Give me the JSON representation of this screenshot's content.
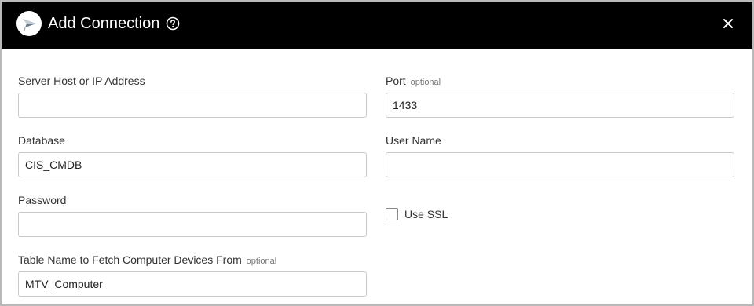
{
  "dialog": {
    "title": "Add Connection",
    "icons": {
      "logo": "paper-plane-logo-icon",
      "help": "question-circle-icon",
      "close": "close-icon"
    },
    "colors": {
      "header_background": "#000000",
      "header_text": "#ffffff",
      "border": "#b9b9b9",
      "input_border": "#c9c9c9",
      "optional_text": "#757575"
    }
  },
  "form": {
    "optional_tag": "optional",
    "server_host": {
      "label": "Server Host or IP Address",
      "value": ""
    },
    "port": {
      "label": "Port",
      "optional": "optional",
      "value": "1433"
    },
    "database": {
      "label": "Database",
      "value": "CIS_CMDB"
    },
    "user_name": {
      "label": "User Name",
      "value": ""
    },
    "password": {
      "label": "Password",
      "value": ""
    },
    "use_ssl": {
      "label": "Use SSL",
      "checked": false
    },
    "table_name": {
      "label": "Table Name to Fetch Computer Devices From",
      "optional": "optional",
      "value": "MTV_Computer"
    }
  }
}
